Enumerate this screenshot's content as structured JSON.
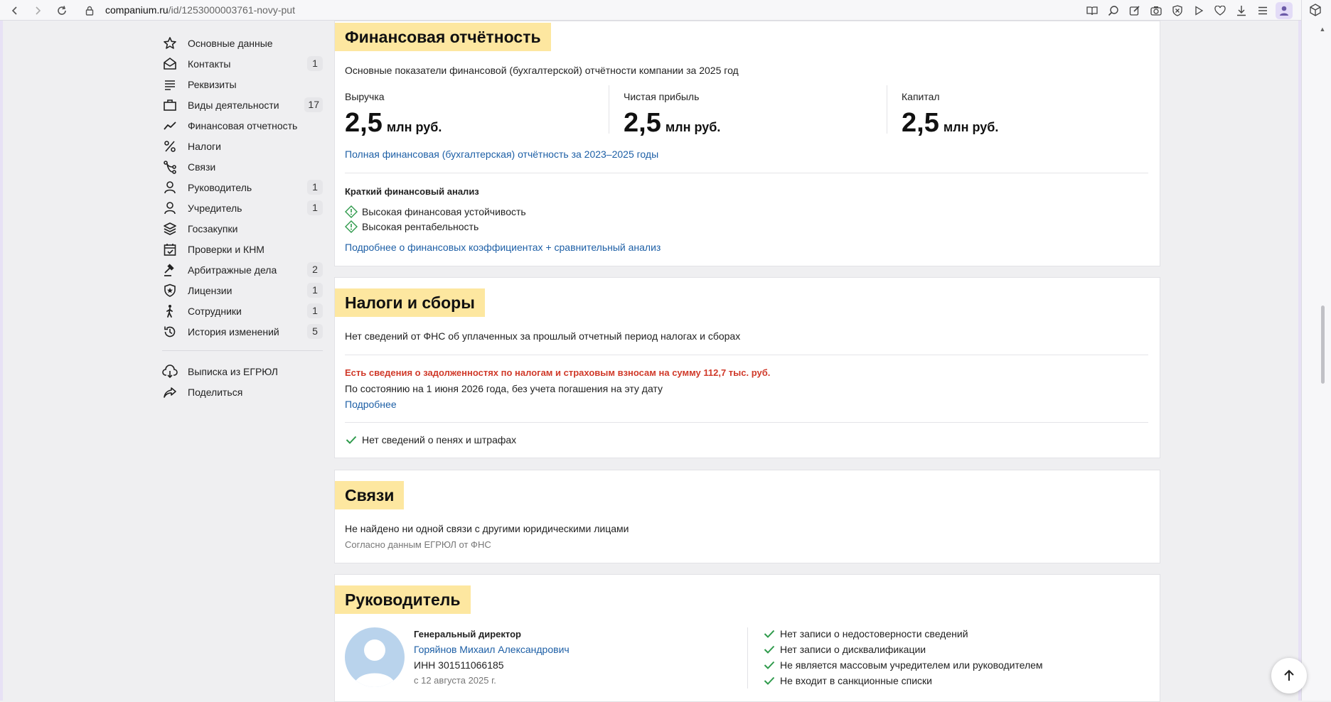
{
  "browser": {
    "url_host": "companium.ru",
    "url_path": "/id/1253000003761-novy-put"
  },
  "sidebar": {
    "items": [
      {
        "label": "Основные данные",
        "icon": "star-icon",
        "badge": ""
      },
      {
        "label": "Контакты",
        "icon": "envelope-icon",
        "badge": "1"
      },
      {
        "label": "Реквизиты",
        "icon": "lines-icon",
        "badge": ""
      },
      {
        "label": "Виды деятельности",
        "icon": "briefcase-icon",
        "badge": "17"
      },
      {
        "label": "Финансовая отчетность",
        "icon": "trend-icon",
        "badge": ""
      },
      {
        "label": "Налоги",
        "icon": "percent-icon",
        "badge": ""
      },
      {
        "label": "Связи",
        "icon": "connections-icon",
        "badge": ""
      },
      {
        "label": "Руководитель",
        "icon": "person-icon",
        "badge": "1"
      },
      {
        "label": "Учредитель",
        "icon": "person-icon",
        "badge": "1"
      },
      {
        "label": "Госзакупки",
        "icon": "layers-icon",
        "badge": ""
      },
      {
        "label": "Проверки и КНМ",
        "icon": "calendar-check-icon",
        "badge": ""
      },
      {
        "label": "Арбитражные дела",
        "icon": "gavel-icon",
        "badge": "2"
      },
      {
        "label": "Лицензии",
        "icon": "shield-star-icon",
        "badge": "1"
      },
      {
        "label": "Сотрудники",
        "icon": "walking-person-icon",
        "badge": "1"
      },
      {
        "label": "История изменений",
        "icon": "history-icon",
        "badge": "5"
      }
    ],
    "extra": [
      {
        "label": "Выписка из ЕГРЮЛ",
        "icon": "cloud-download-icon"
      },
      {
        "label": "Поделиться",
        "icon": "share-icon"
      }
    ]
  },
  "finance": {
    "title": "Финансовая отчётность",
    "subtitle": "Основные показатели финансовой (бухгалтерской) отчётности компании за 2025 год",
    "metrics": [
      {
        "label": "Выручка",
        "value": "2,5",
        "unit": "млн руб."
      },
      {
        "label": "Чистая прибыль",
        "value": "2,5",
        "unit": "млн руб."
      },
      {
        "label": "Капитал",
        "value": "2,5",
        "unit": "млн руб."
      }
    ],
    "full_report_link": "Полная финансовая (бухгалтерская) отчётность за 2023–2025 годы",
    "analysis_title": "Краткий финансовый анализ",
    "analysis_items": [
      "Высокая финансовая устойчивость",
      "Высокая рентабельность"
    ],
    "more_link": "Подробнее о финансовых коэффициентах + сравнительный анализ"
  },
  "taxes": {
    "title": "Налоги и сборы",
    "no_data": "Нет сведений от ФНС об уплаченных за прошлый отчетный период налогах и сборах",
    "debt_warning": "Есть сведения о задолженностях по налогам и страховым взносам на сумму 112,7 тыс. руб.",
    "debt_date": "По состоянию на 1 июня 2026 года, без учета погашения на эту дату",
    "more_link": "Подробнее",
    "penalties": "Нет сведений о пенях и штрафах"
  },
  "links": {
    "title": "Связи",
    "text": "Не найдено ни одной связи с другими юридическими лицами",
    "source": "Согласно данным ЕГРЮЛ от ФНС"
  },
  "head": {
    "title": "Руководитель",
    "position": "Генеральный директор",
    "name": "Горяйнов Михаил Александрович",
    "inn": "ИНН 301511066185",
    "since": "с 12 августа 2025 г.",
    "checks": [
      "Нет записи о недостоверности сведений",
      "Нет записи о дисквалификации",
      "Не является массовым учредителем или руководителем",
      "Не входит в санкционные списки"
    ]
  },
  "colors": {
    "accent_yellow": "#fde7a0",
    "link_blue": "#1d5fa6",
    "warning_red": "#d03a2a",
    "check_green": "#2e9a4b"
  }
}
